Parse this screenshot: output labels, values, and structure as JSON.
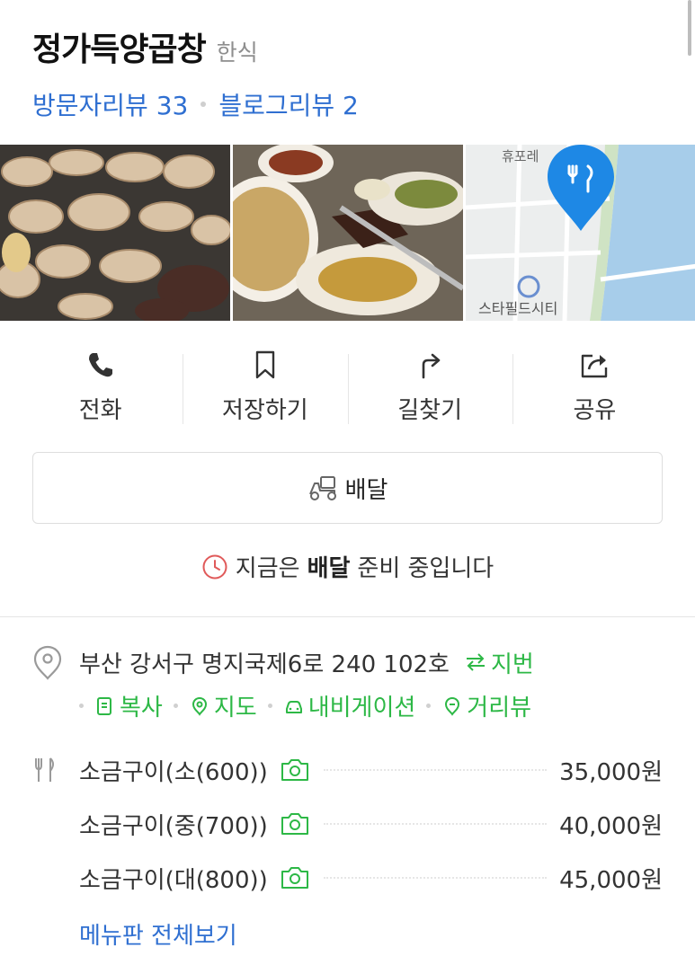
{
  "place": {
    "name": "정가득양곱창",
    "category": "한식"
  },
  "reviews": {
    "visitor": "방문자리뷰 33",
    "blog": "블로그리뷰 2"
  },
  "photos": {
    "map_label_top": "휴포레",
    "map_label_bottom": "스타필드시티"
  },
  "actions": [
    {
      "label": "전화",
      "icon": "phone-icon"
    },
    {
      "label": "저장하기",
      "icon": "bookmark-icon"
    },
    {
      "label": "길찾기",
      "icon": "directions-icon"
    },
    {
      "label": "공유",
      "icon": "share-icon"
    }
  ],
  "delivery": {
    "button_label": "배달",
    "notice_pre": "지금은",
    "notice_bold": "배달",
    "notice_post": "준비 중입니다"
  },
  "address": {
    "text": "부산 강서구 명지국제6로 240 102호",
    "jibun_label": "지번",
    "links": [
      "복사",
      "지도",
      "내비게이션",
      "거리뷰"
    ]
  },
  "menu": {
    "items": [
      {
        "name": "소금구이(소(600))",
        "price": "35,000원"
      },
      {
        "name": "소금구이(중(700))",
        "price": "40,000원"
      },
      {
        "name": "소금구이(대(800))",
        "price": "45,000원"
      }
    ],
    "view_all": "메뉴판 전체보기"
  },
  "colors": {
    "link_blue": "#2f6fd1",
    "green": "#2db846",
    "pin_blue": "#1e88e5",
    "clock_red": "#e05a5a"
  }
}
